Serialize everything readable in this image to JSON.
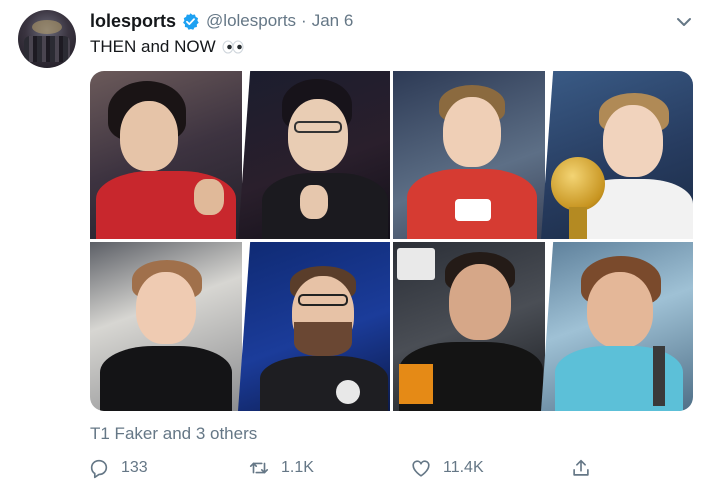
{
  "tweet": {
    "display_name": "lolesports",
    "handle": "@lolesports",
    "separator": "·",
    "date": "Jan 6",
    "text": "THEN and NOW",
    "verified": true,
    "verified_color": "#1da1f2",
    "tagged": "T1 Faker and 3 others",
    "media_count": 4
  },
  "actions": {
    "reply_count": "133",
    "retweet_count": "1.1K",
    "like_count": "11.4K"
  },
  "icons": {
    "verified": "verified-badge-icon",
    "more": "chevron-down-icon",
    "emoji": "eyes-emoji-icon",
    "reply": "reply-icon",
    "retweet": "retweet-icon",
    "like": "heart-icon",
    "share": "share-icon"
  },
  "colors": {
    "text": "#14171a",
    "muted": "#657786",
    "brand": "#1da1f2"
  }
}
